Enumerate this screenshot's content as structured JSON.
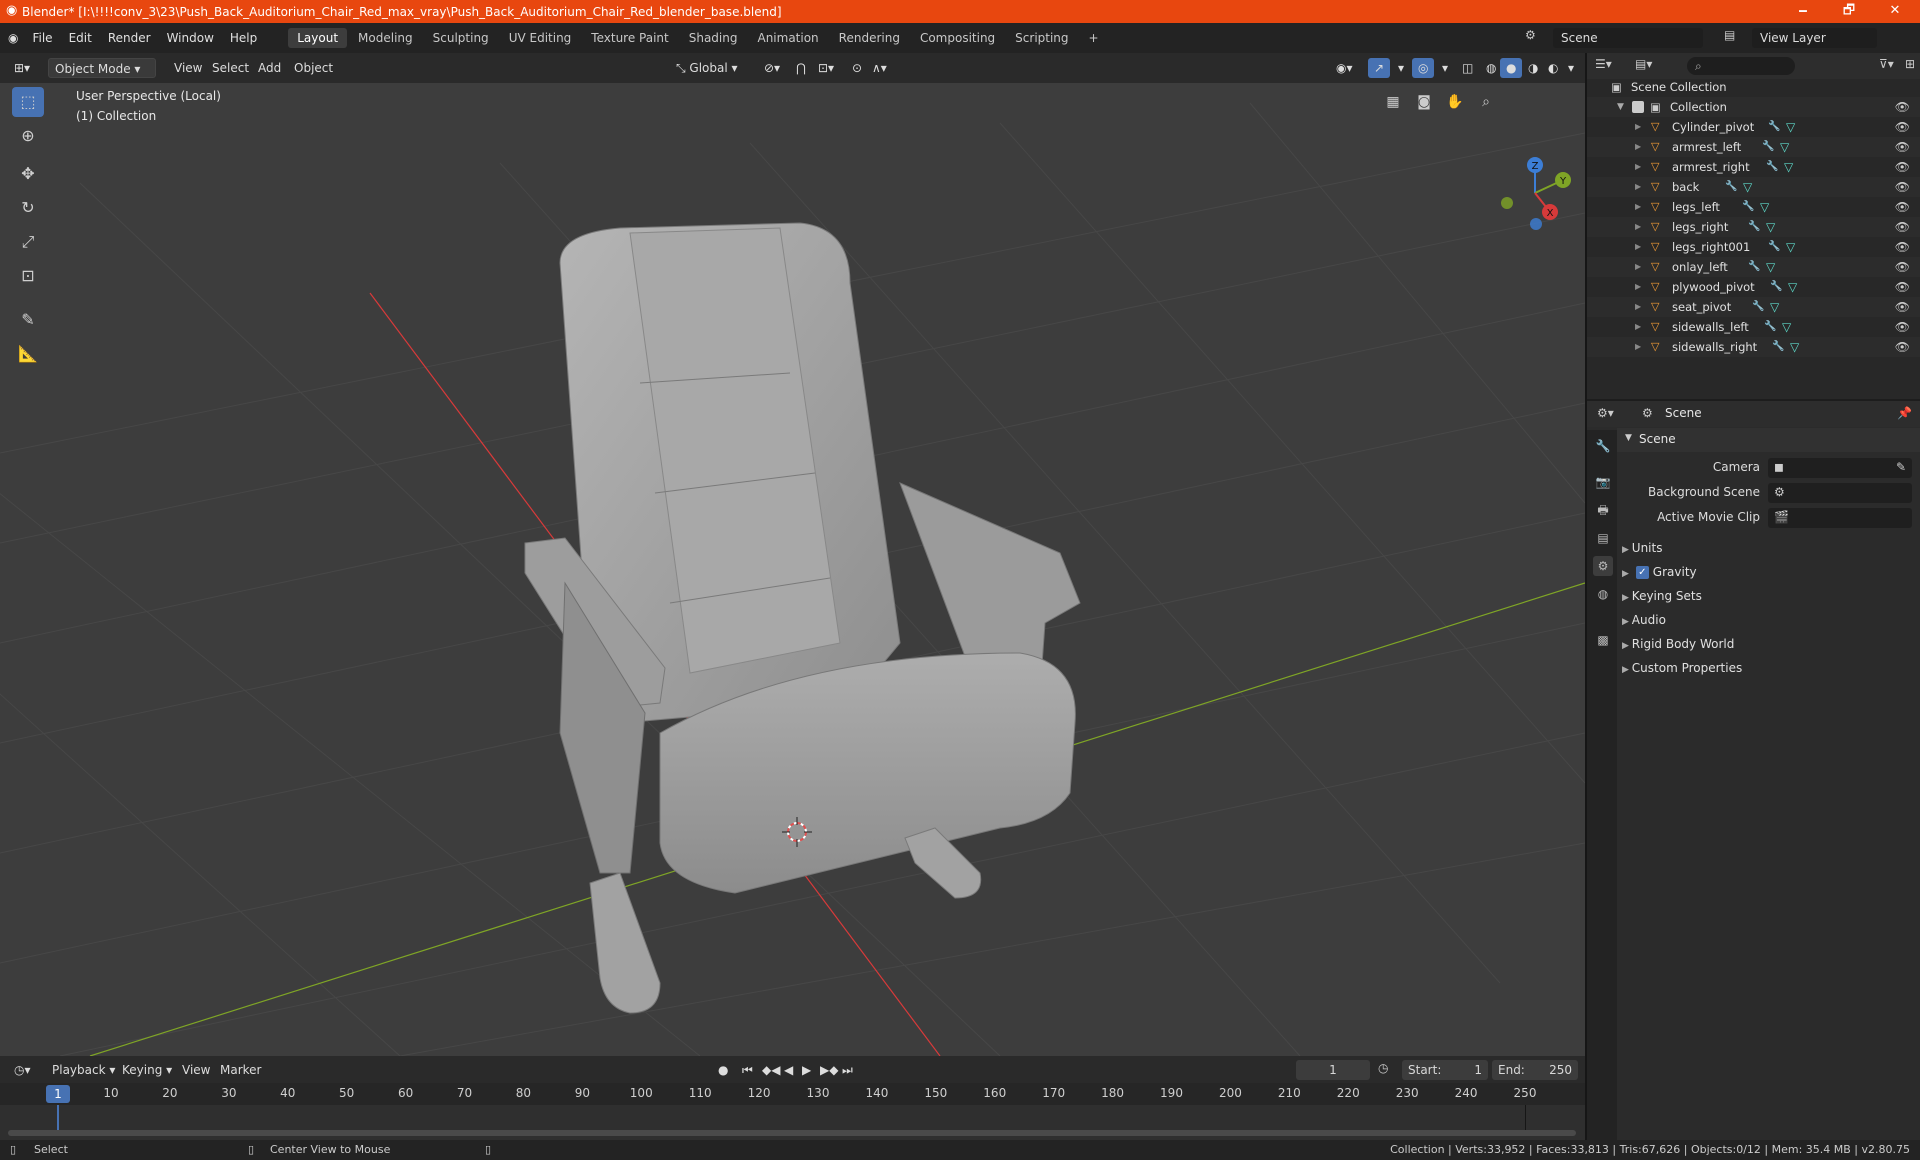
{
  "window": {
    "title": "Blender* [I:\\!!!!conv_3\\23\\Push_Back_Auditorium_Chair_Red_max_vray\\Push_Back_Auditorium_Chair_Red_blender_base.blend]",
    "minimize": "🗕",
    "maximize": "🗗",
    "close": "✕"
  },
  "menu": [
    "File",
    "Edit",
    "Render",
    "Window",
    "Help"
  ],
  "workspaces": [
    "Layout",
    "Modeling",
    "Sculpting",
    "UV Editing",
    "Texture Paint",
    "Shading",
    "Animation",
    "Rendering",
    "Compositing",
    "Scripting"
  ],
  "workspace_add": "+",
  "scene_field": "Scene",
  "view_layer_field": "View Layer",
  "viewport": {
    "mode": "Object Mode",
    "menus": [
      "View",
      "Select",
      "Add",
      "Object"
    ],
    "transform_orientation": "Global",
    "overlay_line1": "User Perspective (Local)",
    "overlay_line2": "(1) Collection",
    "gizmo_axes": {
      "x": "X",
      "y": "Y",
      "z": "Z"
    }
  },
  "outliner": {
    "scene_collection": "Scene Collection",
    "collection": "Collection",
    "objects": [
      "Cylinder_pivot",
      "armrest_left",
      "armrest_right",
      "back",
      "legs_left",
      "legs_right",
      "legs_right001",
      "onlay_left",
      "plywood_pivot",
      "seat_pivot",
      "sidewalls_left",
      "sidewalls_right"
    ]
  },
  "properties": {
    "context": "Scene",
    "panel": "Scene",
    "fields": [
      {
        "label": "Camera",
        "value": ""
      },
      {
        "label": "Background Scene",
        "value": ""
      },
      {
        "label": "Active Movie Clip",
        "value": ""
      }
    ],
    "sections": [
      "Units",
      "Gravity",
      "Keying Sets",
      "Audio",
      "Rigid Body World",
      "Custom Properties"
    ],
    "gravity_enabled": true
  },
  "timeline": {
    "menus": [
      "Playback",
      "Keying",
      "View",
      "Marker"
    ],
    "current_frame": "1",
    "start_label": "Start:",
    "start": "1",
    "end_label": "End:",
    "end": "250",
    "ruler": [
      "10",
      "20",
      "30",
      "40",
      "50",
      "60",
      "70",
      "80",
      "90",
      "100",
      "110",
      "120",
      "130",
      "140",
      "150",
      "160",
      "170",
      "180",
      "190",
      "200",
      "210",
      "220",
      "230",
      "240",
      "250"
    ],
    "playhead": "1"
  },
  "status": {
    "left_action": "Select",
    "mid_action": "Center View to Mouse",
    "stats": "Collection | Verts:33,952 | Faces:33,813 | Tris:67,626 | Objects:0/12 | Mem: 35.4 MB | v2.80.75"
  },
  "colors": {
    "accent": "#4772b3",
    "titlebar": "#e8470f",
    "object_icon": "#f29b35",
    "x_axis": "#d73a3a",
    "y_axis": "#7fa526",
    "z_axis": "#3c7ed6"
  }
}
